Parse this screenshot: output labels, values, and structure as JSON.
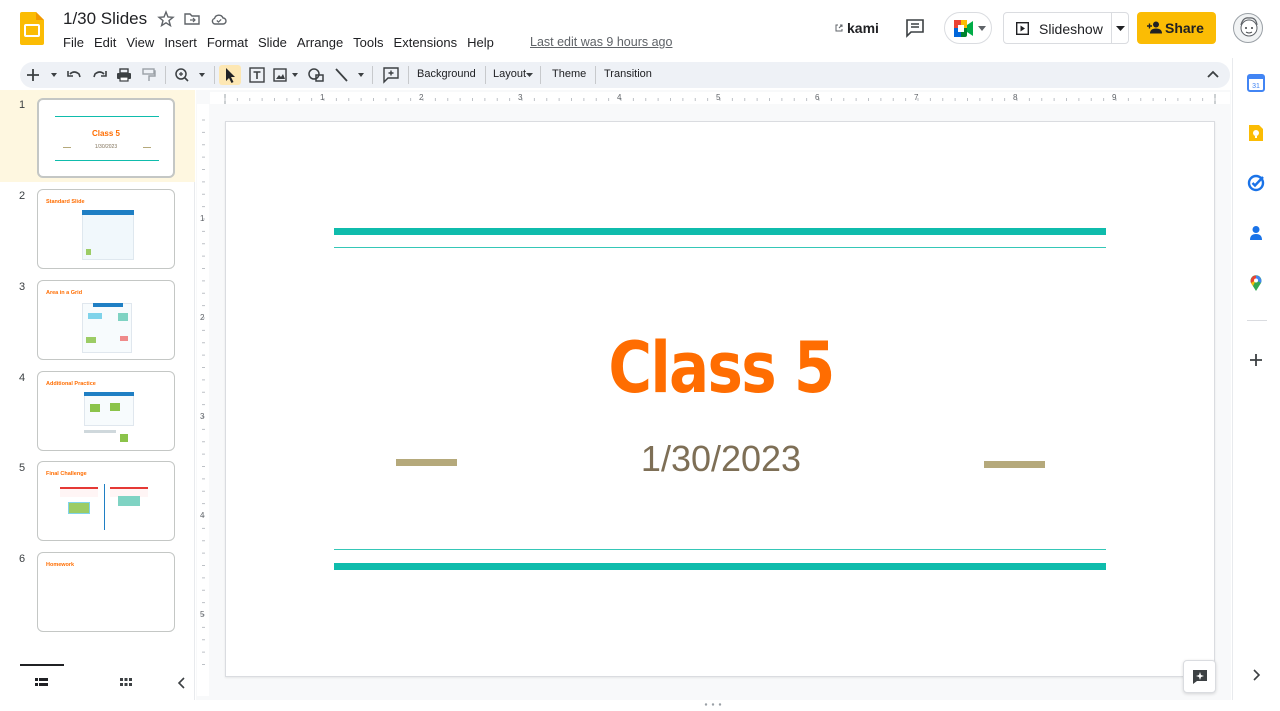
{
  "header": {
    "title": "1/30 Slides",
    "menu": [
      "File",
      "Edit",
      "View",
      "Insert",
      "Format",
      "Slide",
      "Arrange",
      "Tools",
      "Extensions",
      "Help"
    ],
    "last_edit": "Last edit was 9 hours ago",
    "kami": "kami",
    "slideshow": "Slideshow",
    "share": "Share"
  },
  "toolbar": {
    "background": "Background",
    "layout": "Layout",
    "theme": "Theme",
    "transition": "Transition"
  },
  "ruler": {
    "top": [
      "1",
      "2",
      "3",
      "4",
      "5",
      "6",
      "7",
      "8",
      "9"
    ],
    "left": [
      "1",
      "2",
      "3",
      "4",
      "5"
    ]
  },
  "slides": [
    {
      "number": "1",
      "title": "Class 5",
      "subtitle": "1/30/2023"
    },
    {
      "number": "2",
      "title": "Standard Slide"
    },
    {
      "number": "3",
      "title": "Area in a Grid"
    },
    {
      "number": "4",
      "title": "Additional Practice"
    },
    {
      "number": "5",
      "title": "Final Challenge"
    },
    {
      "number": "6",
      "title": "Homework"
    }
  ],
  "current_slide": {
    "title": "Class 5",
    "subtitle": "1/30/2023"
  },
  "colors": {
    "accent_teal": "#0fbcac",
    "title_orange": "#ff6d01",
    "subtitle_brown": "#7e6f56",
    "tan": "#b5a97b",
    "share_yellow": "#fbbc04"
  },
  "side_panel_icons": [
    "calendar-icon",
    "keep-icon",
    "tasks-icon",
    "contacts-icon",
    "maps-icon",
    "add-icon"
  ]
}
